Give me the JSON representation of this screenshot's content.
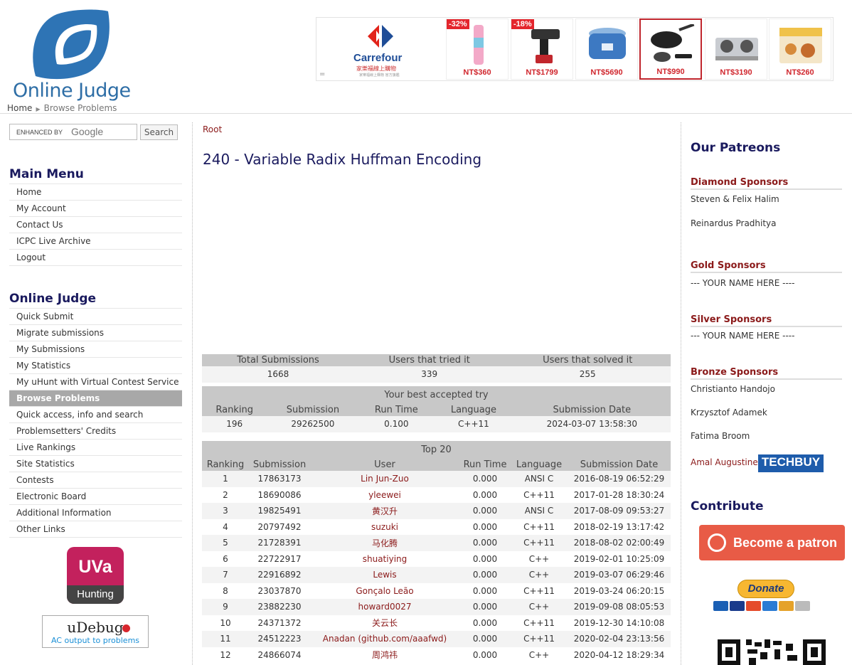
{
  "header": {
    "logo_text": "Online Judge",
    "breadcrumb": [
      "Home",
      "Browse Problems"
    ]
  },
  "ad": {
    "brand_name": "Carrefour",
    "brand_sub": "家樂福線上購物",
    "brand_sub2": "家樂福線上購物  官方旗艦",
    "menu_glyph": "=",
    "items": [
      {
        "price": "NT$360",
        "discount": "-32%",
        "icon": "drink-can-icon"
      },
      {
        "price": "NT$1799",
        "discount": "-18%",
        "icon": "power-drill-icon"
      },
      {
        "price": "NT$5690",
        "discount": "",
        "icon": "rice-cooker-icon"
      },
      {
        "price": "NT$990",
        "discount": "",
        "icon": "wok-pan-icon"
      },
      {
        "price": "NT$3190",
        "discount": "",
        "icon": "gas-stove-icon"
      },
      {
        "price": "NT$260",
        "discount": "",
        "icon": "snack-box-icon"
      }
    ]
  },
  "search": {
    "enhanced_by": "ENHANCED BY",
    "google": "Google",
    "button": "Search"
  },
  "main_menu": {
    "title": "Main Menu",
    "items": [
      "Home",
      "My Account",
      "Contact Us",
      "ICPC Live Archive",
      "Logout"
    ]
  },
  "oj_menu": {
    "title": "Online Judge",
    "items": [
      "Quick Submit",
      "Migrate submissions",
      "My Submissions",
      "My Statistics",
      "My uHunt with Virtual Contest Service",
      "Browse Problems",
      "Quick access, info and search",
      "Problemsetters' Credits",
      "Live Rankings",
      "Site Statistics",
      "Contests",
      "Electronic Board",
      "Additional Information",
      "Other Links"
    ],
    "active_index": 5
  },
  "badges": {
    "uva_top": "UVa",
    "uva_bottom": "Hunting",
    "udebug_title": "uDebug",
    "udebug_sub": "AC output to problems"
  },
  "problem": {
    "root": "Root",
    "title": "240 - Variable Radix Huffman Encoding"
  },
  "stats": {
    "headers": [
      "Total Submissions",
      "Users that tried it",
      "Users that solved it"
    ],
    "values": [
      "1668",
      "339",
      "255"
    ]
  },
  "best_try": {
    "caption": "Your best accepted try",
    "headers": [
      "Ranking",
      "Submission",
      "Run Time",
      "Language",
      "Submission Date"
    ],
    "row": [
      "196",
      "29262500",
      "0.100",
      "C++11",
      "2024-03-07 13:58:30"
    ]
  },
  "top20": {
    "caption": "Top 20",
    "headers": [
      "Ranking",
      "Submission",
      "User",
      "Run Time",
      "Language",
      "Submission Date"
    ],
    "rows": [
      [
        "1",
        "17863173",
        "Lin Jun-Zuo",
        "0.000",
        "ANSI C",
        "2016-08-19 06:52:29"
      ],
      [
        "2",
        "18690086",
        "yleewei",
        "0.000",
        "C++11",
        "2017-01-28 18:30:24"
      ],
      [
        "3",
        "19825491",
        "黄汉升",
        "0.000",
        "ANSI C",
        "2017-08-09 09:53:27"
      ],
      [
        "4",
        "20797492",
        "suzuki",
        "0.000",
        "C++11",
        "2018-02-19 13:17:42"
      ],
      [
        "5",
        "21728391",
        "马化腾",
        "0.000",
        "C++11",
        "2018-08-02 02:00:49"
      ],
      [
        "6",
        "22722917",
        "shuatiying",
        "0.000",
        "C++",
        "2019-02-01 10:25:09"
      ],
      [
        "7",
        "22916892",
        "Lewis",
        "0.000",
        "C++",
        "2019-03-07 06:29:46"
      ],
      [
        "8",
        "23037870",
        "Gonçalo Leão",
        "0.000",
        "C++11",
        "2019-03-24 06:20:15"
      ],
      [
        "9",
        "23882230",
        "howard0027",
        "0.000",
        "C++",
        "2019-09-08 08:05:53"
      ],
      [
        "10",
        "24371372",
        "关云长",
        "0.000",
        "C++11",
        "2019-12-30 14:10:08"
      ],
      [
        "11",
        "24512223",
        "Anadan (github.com/aaafwd)",
        "0.000",
        "C++11",
        "2020-02-04 23:13:56"
      ],
      [
        "12",
        "24866074",
        "周鸿祎",
        "0.000",
        "C++",
        "2020-04-12 18:29:34"
      ]
    ]
  },
  "patreons": {
    "title": "Our Patreons",
    "diamond_title": "Diamond Sponsors",
    "diamond": [
      "Steven & Felix Halim",
      "Reinardus Pradhitya"
    ],
    "gold_title": "Gold Sponsors",
    "gold": [
      "--- YOUR NAME HERE ----"
    ],
    "silver_title": "Silver Sponsors",
    "silver": [
      "--- YOUR NAME HERE ----"
    ],
    "bronze_title": "Bronze Sponsors",
    "bronze": [
      "Christianto Handojo",
      "Krzysztof Adamek",
      "Fatima Broom",
      "Amal Augustine"
    ],
    "techbuy": "TECHBUY",
    "contribute_title": "Contribute",
    "patron_button": "Become a patron",
    "donate_button": "Donate"
  }
}
